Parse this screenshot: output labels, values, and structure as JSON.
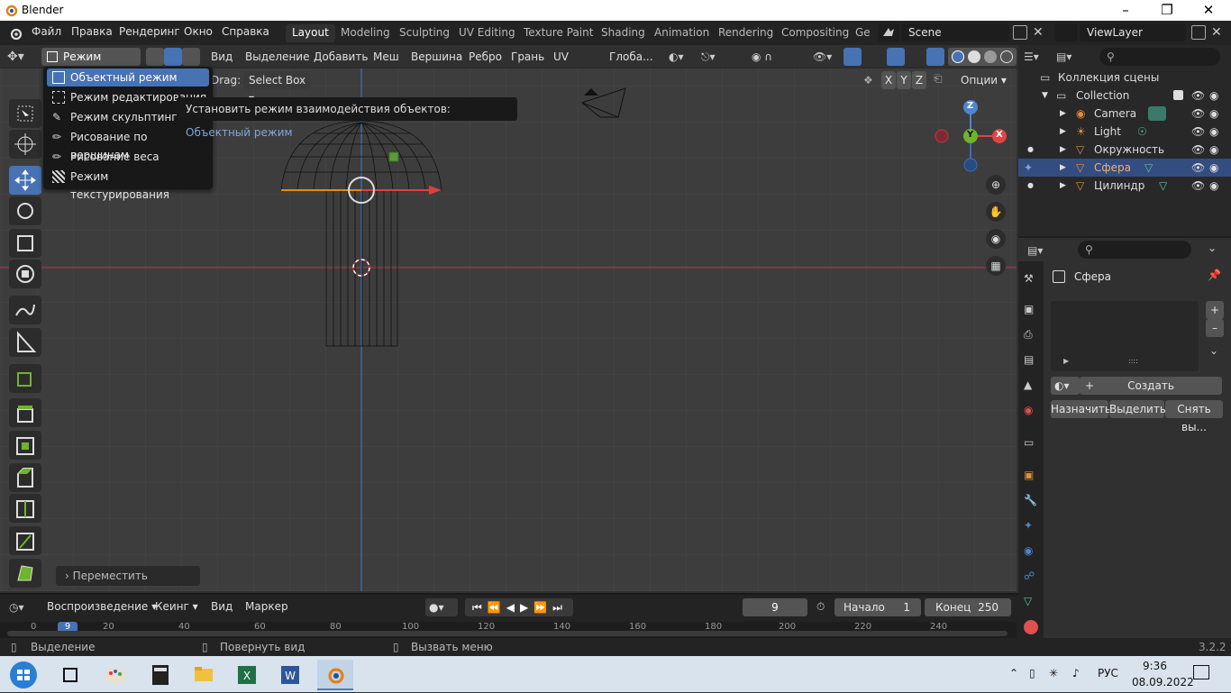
{
  "window": {
    "title": "Blender"
  },
  "menu": {
    "file": "Файл",
    "edit": "Правка",
    "render": "Рендеринг",
    "window": "Окно",
    "help": "Справка"
  },
  "workspaces": [
    "Layout",
    "Modeling",
    "Sculpting",
    "UV Editing",
    "Texture Paint",
    "Shading",
    "Animation",
    "Rendering",
    "Compositing",
    "Ge"
  ],
  "scene": {
    "name": "Scene"
  },
  "view_layer": {
    "name": "ViewLayer"
  },
  "header": {
    "mode": "Режим реда...",
    "view": "Вид",
    "select": "Выделение",
    "add": "Добавить",
    "mesh": "Меш",
    "vertex": "Вершина",
    "edge": "Ребро",
    "face": "Грань",
    "uv": "UV",
    "transform_orientation": "Глоба...",
    "drag_label": "Drag:",
    "drag_value": "Select Box",
    "axis_x": "X",
    "axis_y": "Y",
    "axis_z": "Z",
    "options": "Опции"
  },
  "mode_menu": {
    "items": [
      "Объектный режим",
      "Режим редактирования",
      "Режим скульптинга",
      "Рисование по вершинам",
      "Рисование веса",
      "Режим текстурирования"
    ]
  },
  "tooltip": {
    "text": "Установить режим взаимодействия объектов:",
    "value": "Объектный режим"
  },
  "gizmo": {
    "x": "X",
    "y": "Y",
    "z": "Z"
  },
  "last_op": {
    "label": "Переместить"
  },
  "outliner": {
    "root": "Коллекция сцены",
    "collection": "Collection",
    "items": [
      "Camera",
      "Light",
      "Окружность",
      "Сфера",
      "Цилиндр"
    ]
  },
  "properties": {
    "object": "Сфера",
    "new_label": "Создать",
    "assign": "Назначить",
    "select": "Выделить",
    "deselect": "Снять вы..."
  },
  "timeline": {
    "playback": "Воспроизведение",
    "keying": "Кеинг",
    "view": "Вид",
    "marker": "Маркер",
    "current_frame": "9",
    "start_label": "Начало",
    "start": "1",
    "end_label": "Конец",
    "end": "250",
    "ticks": [
      "0",
      "9",
      "120",
      "140",
      "160",
      "180",
      "200",
      "220",
      "240"
    ],
    "tick_partial": [
      "20",
      "40",
      "60",
      "80",
      "100"
    ]
  },
  "status": {
    "select": "Выделение",
    "rotate": "Повернуть вид",
    "menu": "Вызвать меню",
    "version": "3.2.2"
  },
  "taskbar": {
    "lang": "РУС",
    "time": "9:36",
    "date": "08.09.2022"
  }
}
